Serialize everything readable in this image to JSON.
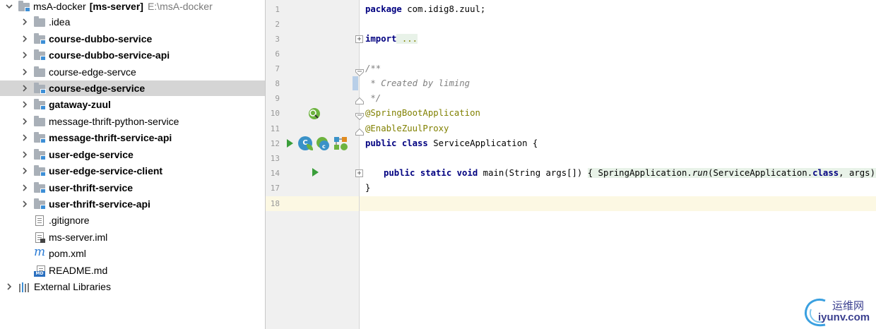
{
  "project_tree": {
    "root": {
      "name": "msA-docker",
      "module": "[ms-server]",
      "path": "E:\\msA-docker"
    },
    "items": [
      {
        "label": ".idea",
        "bold": false
      },
      {
        "label": "course-dubbo-service",
        "bold": true
      },
      {
        "label": "course-dubbo-service-api",
        "bold": true
      },
      {
        "label": "course-edge-servce",
        "bold": false
      },
      {
        "label": "course-edge-service",
        "bold": true,
        "selected": true
      },
      {
        "label": "gataway-zuul",
        "bold": true
      },
      {
        "label": "message-thrift-python-service",
        "bold": false
      },
      {
        "label": "message-thrift-service-api",
        "bold": true
      },
      {
        "label": "user-edge-service",
        "bold": true
      },
      {
        "label": "user-edge-service-client",
        "bold": true
      },
      {
        "label": "user-thrift-service",
        "bold": true
      },
      {
        "label": "user-thrift-service-api",
        "bold": true
      },
      {
        "label": ".gitignore",
        "icon": "text-file-icon"
      },
      {
        "label": "ms-server.iml",
        "icon": "iml-file-icon"
      },
      {
        "label": "pom.xml",
        "icon": "maven-icon"
      },
      {
        "label": "README.md",
        "icon": "markdown-icon"
      }
    ],
    "external_libraries": "External Libraries"
  },
  "editor": {
    "line_numbers": [
      "1",
      "2",
      "3",
      "6",
      "7",
      "8",
      "9",
      "10",
      "11",
      "12",
      "13",
      "14",
      "17",
      "18"
    ],
    "code": {
      "l1_kw": "package",
      "l1_rest": " com.idig8.zuul;",
      "l3_kw": "import",
      "l3_fold": " ...",
      "l7": "/**",
      "l8": " * Created by liming",
      "l9": " */",
      "l10": "@SpringBootApplication",
      "l11": "@EnableZuulProxy",
      "l12_kw": "public class",
      "l12_rest": " ServiceApplication {",
      "l14_kw": "public static void",
      "l14_main": " main(String args[]) ",
      "l14_fold_open": "{ SpringApplication.",
      "l14_run": "run",
      "l14_mid": "(ServiceApplication.",
      "l14_class": "class",
      "l14_end": ", args); }",
      "l17": "}"
    }
  },
  "watermark": {
    "cn": "运维网",
    "url": "iyunv.com"
  },
  "colors": {
    "keyword": "#000080",
    "annotation": "#808000",
    "comment": "#808080",
    "selected_row": "#d5d5d5",
    "current_line": "#fcf8e3"
  }
}
